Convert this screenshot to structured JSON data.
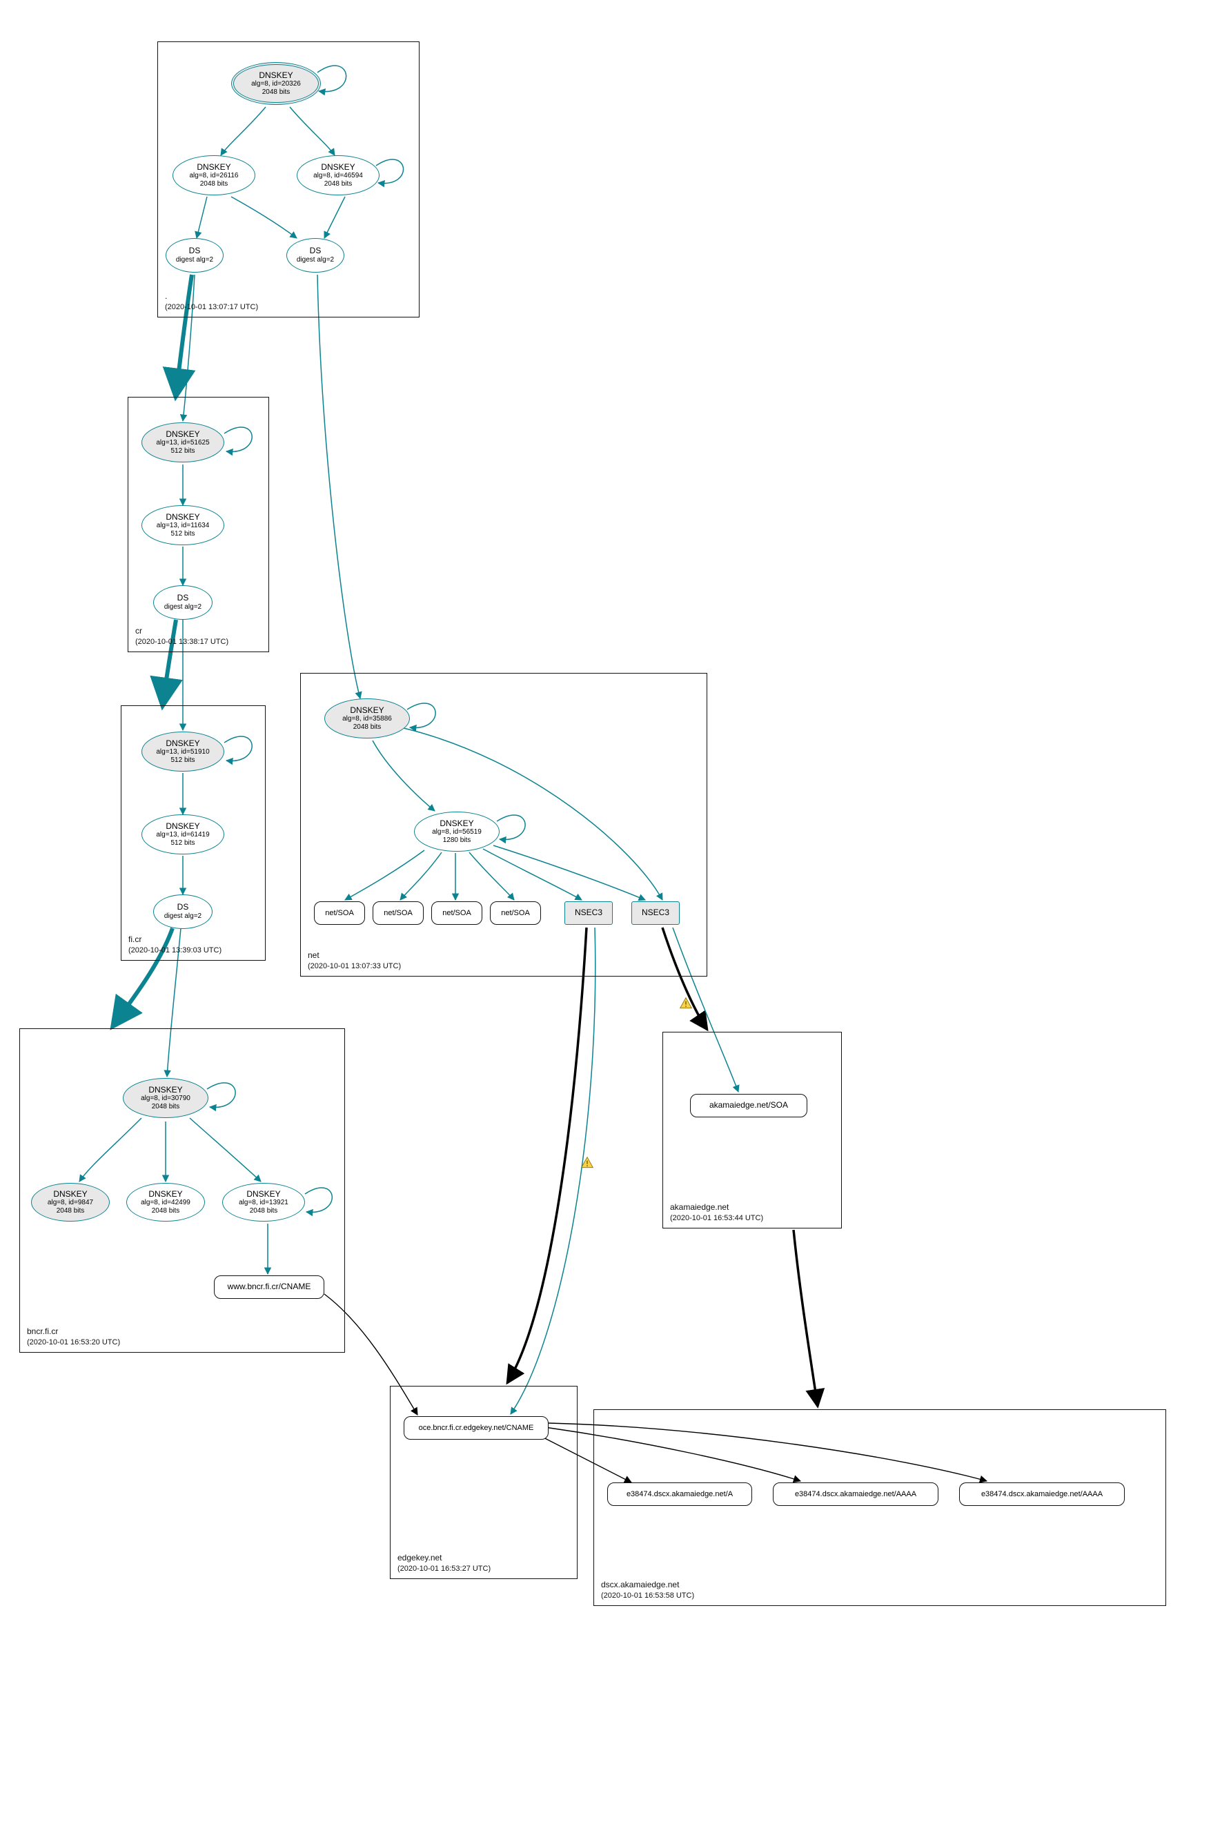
{
  "zones": {
    "root": {
      "name": ".",
      "time": "(2020-10-01 13:07:17 UTC)"
    },
    "cr": {
      "name": "cr",
      "time": "(2020-10-01 13:38:17 UTC)"
    },
    "ficr": {
      "name": "fi.cr",
      "time": "(2020-10-01 13:39:03 UTC)"
    },
    "bncr": {
      "name": "bncr.fi.cr",
      "time": "(2020-10-01 16:53:20 UTC)"
    },
    "net": {
      "name": "net",
      "time": "(2020-10-01 13:07:33 UTC)"
    },
    "akamaiedge": {
      "name": "akamaiedge.net",
      "time": "(2020-10-01 16:53:44 UTC)"
    },
    "edgekey": {
      "name": "edgekey.net",
      "time": "(2020-10-01 16:53:27 UTC)"
    },
    "dscx": {
      "name": "dscx.akamaiedge.net",
      "time": "(2020-10-01 16:53:58 UTC)"
    }
  },
  "keys": {
    "root_ksk": {
      "title": "DNSKEY",
      "sub": "alg=8, id=20326",
      "bits": "2048 bits"
    },
    "root_zsk1": {
      "title": "DNSKEY",
      "sub": "alg=8, id=26116",
      "bits": "2048 bits"
    },
    "root_zsk2": {
      "title": "DNSKEY",
      "sub": "alg=8, id=46594",
      "bits": "2048 bits"
    },
    "cr_ksk": {
      "title": "DNSKEY",
      "sub": "alg=13, id=51625",
      "bits": "512 bits"
    },
    "cr_zsk": {
      "title": "DNSKEY",
      "sub": "alg=13, id=11634",
      "bits": "512 bits"
    },
    "ficr_ksk": {
      "title": "DNSKEY",
      "sub": "alg=13, id=51910",
      "bits": "512 bits"
    },
    "ficr_zsk": {
      "title": "DNSKEY",
      "sub": "alg=13, id=61419",
      "bits": "512 bits"
    },
    "bncr_ksk": {
      "title": "DNSKEY",
      "sub": "alg=8, id=30790",
      "bits": "2048 bits"
    },
    "bncr_z1": {
      "title": "DNSKEY",
      "sub": "alg=8, id=9847",
      "bits": "2048 bits"
    },
    "bncr_z2": {
      "title": "DNSKEY",
      "sub": "alg=8, id=42499",
      "bits": "2048 bits"
    },
    "bncr_z3": {
      "title": "DNSKEY",
      "sub": "alg=8, id=13921",
      "bits": "2048 bits"
    },
    "net_ksk": {
      "title": "DNSKEY",
      "sub": "alg=8, id=35886",
      "bits": "2048 bits"
    },
    "net_zsk": {
      "title": "DNSKEY",
      "sub": "alg=8, id=56519",
      "bits": "1280 bits"
    }
  },
  "ds": {
    "root_ds1": {
      "title": "DS",
      "sub": "digest alg=2"
    },
    "root_ds2": {
      "title": "DS",
      "sub": "digest alg=2"
    },
    "cr_ds": {
      "title": "DS",
      "sub": "digest alg=2"
    },
    "ficr_ds": {
      "title": "DS",
      "sub": "digest alg=2"
    }
  },
  "records": {
    "netsoa": "net/SOA",
    "nsec3": "NSEC3",
    "akamaiedge_soa": "akamaiedge.net/SOA",
    "bncr_cname": "www.bncr.fi.cr/CNAME",
    "edgekey_cname": "oce.bncr.fi.cr.edgekey.net/CNAME",
    "dscx_a": "e38474.dscx.akamaiedge.net/A",
    "dscx_aaaa": "e38474.dscx.akamaiedge.net/AAAA"
  }
}
